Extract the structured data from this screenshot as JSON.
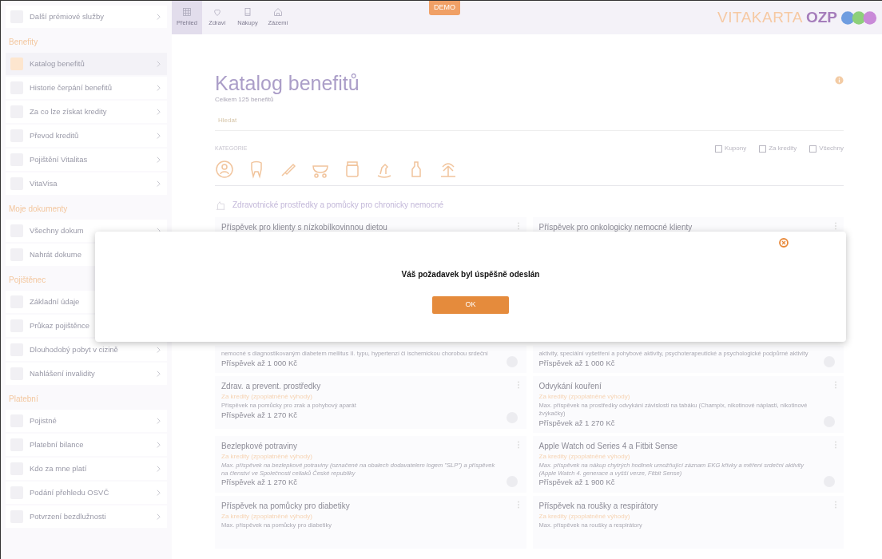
{
  "sidebar": {
    "sections": [
      {
        "items": [
          {
            "label": "Další prémiové služby",
            "selected": false
          }
        ]
      },
      {
        "title": "Benefity",
        "items": [
          {
            "label": "Katalog benefitů",
            "selected": true
          },
          {
            "label": "Historie čerpání benefitů",
            "selected": false
          },
          {
            "label": "Za co lze získat kredity",
            "selected": false
          },
          {
            "label": "Převod kreditů",
            "selected": false
          },
          {
            "label": "Pojištění Vitalitas",
            "selected": false
          },
          {
            "label": "VitaVisa",
            "selected": false
          }
        ]
      },
      {
        "title": "Moje dokumenty",
        "items": [
          {
            "label": "Všechny dokum",
            "selected": false
          },
          {
            "label": "Nahrát dokume",
            "selected": false
          }
        ]
      },
      {
        "title": "Pojištěnec",
        "items": [
          {
            "label": "Základní údaje",
            "selected": false
          },
          {
            "label": "Průkaz pojištěnce",
            "selected": false
          },
          {
            "label": "Dlouhodobý pobyt v cizině",
            "selected": false
          },
          {
            "label": "Nahlášení invalidity",
            "selected": false
          }
        ]
      },
      {
        "title": "Platební",
        "items": [
          {
            "label": "Pojistné",
            "selected": false
          },
          {
            "label": "Platební bilance",
            "selected": false
          },
          {
            "label": "Kdo za mne platí",
            "selected": false
          },
          {
            "label": "Podání přehledu OSVČ",
            "selected": false
          },
          {
            "label": "Potvrzení bezdlužnosti",
            "selected": false
          }
        ]
      }
    ]
  },
  "topbar": {
    "nav": [
      {
        "label": "Přehled",
        "selected": true
      },
      {
        "label": "Zdraví",
        "selected": false
      },
      {
        "label": "Nákupy",
        "selected": false
      },
      {
        "label": "Zázemí",
        "selected": false
      }
    ],
    "badge": "DEMO",
    "logo": {
      "word": "VITAKARTA",
      "brand": "OZP"
    }
  },
  "page": {
    "title": "Katalog benefitů",
    "subtitle": "Celkem 125 benefitů",
    "search": {
      "placeholder": "Hledat"
    },
    "categories_label": "KATEGORIE",
    "filters": [
      {
        "label": "Kupony",
        "checked": false
      },
      {
        "label": "Za kredity",
        "checked": false
      },
      {
        "label": "Všechny",
        "checked": false
      }
    ],
    "section_title": "Zdravotnické prostředky a pomůcky pro chronicky nemocné",
    "card_rows": [
      [
        {
          "title": "Příspěvek pro klienty s nízkobílkovinnou dietou"
        },
        {
          "title": "Příspěvek pro onkologicky nemocné klienty"
        }
      ],
      [
        {
          "description": "nemocné s diagnostikovaným diabetem mellitus II. typu, hypertenzí či ischemickou chorobou srdeční",
          "price": "Příspěvek až 1 000 Kč"
        },
        {
          "description": "aktivity, speciální vyšetření a pohybové aktivity, psychoterapeutické a psychologické podpůrné aktivity",
          "price": "Příspěvek až 1 000 Kč"
        }
      ],
      [
        {
          "title": "Zdrav. a prevent. prostředky",
          "tag": "Za kredity (zpoplatněné výhody)",
          "description": "Příspěvek na pomůcky pro zrak a pohybový aparát",
          "price": "Příspěvek až 1 270 Kč"
        },
        {
          "title": "Odvykání kouření",
          "tag": "Za kredity (zpoplatněné výhody)",
          "description": "Max. příspěvek na prostředky odvykání závislosti na tabáku (Champix, nikotinové náplasti, nikotinové žvýkačky)",
          "price": "Příspěvek až 1 270 Kč"
        }
      ],
      [
        {
          "title": "Bezlepkové potraviny",
          "tag": "Za kredity (zpoplatněné výhody)",
          "description": "*Max. příspěvek na bezlepkové potraviny (označené na obalech dodavatelem logem \"SLP\") a příspěvek na členství ve Společnosti celiaků České republiky*",
          "price": "Příspěvek až 1 270 Kč"
        },
        {
          "title": "Apple Watch od Series 4 a Fitbit Sense",
          "tag": "Za kredity (zpoplatněné výhody)",
          "description": "*Max. příspěvek na nákup chytrých hodinek umožňující záznam EKG křivky a měření srdeční aktivity (Apple Watch 4. generace a vyšší verze, Fitbit Sense)*",
          "price": "Příspěvek až 1 900 Kč"
        }
      ],
      [
        {
          "title": "Příspěvek na pomůcky pro diabetiky",
          "tag": "Za kredity (zpoplatněné výhody)",
          "description": "Max. příspěvek na pomůcky pro diabetiky"
        },
        {
          "title": "Příspěvek na roušky a respirátory",
          "tag": "Za kredity (zpoplatněné výhody)",
          "description": "Max. příspěvek na roušky a respirátory"
        }
      ]
    ]
  },
  "modal": {
    "message": "Váš požadavek byl úspěšně odeslán",
    "button": "OK"
  }
}
